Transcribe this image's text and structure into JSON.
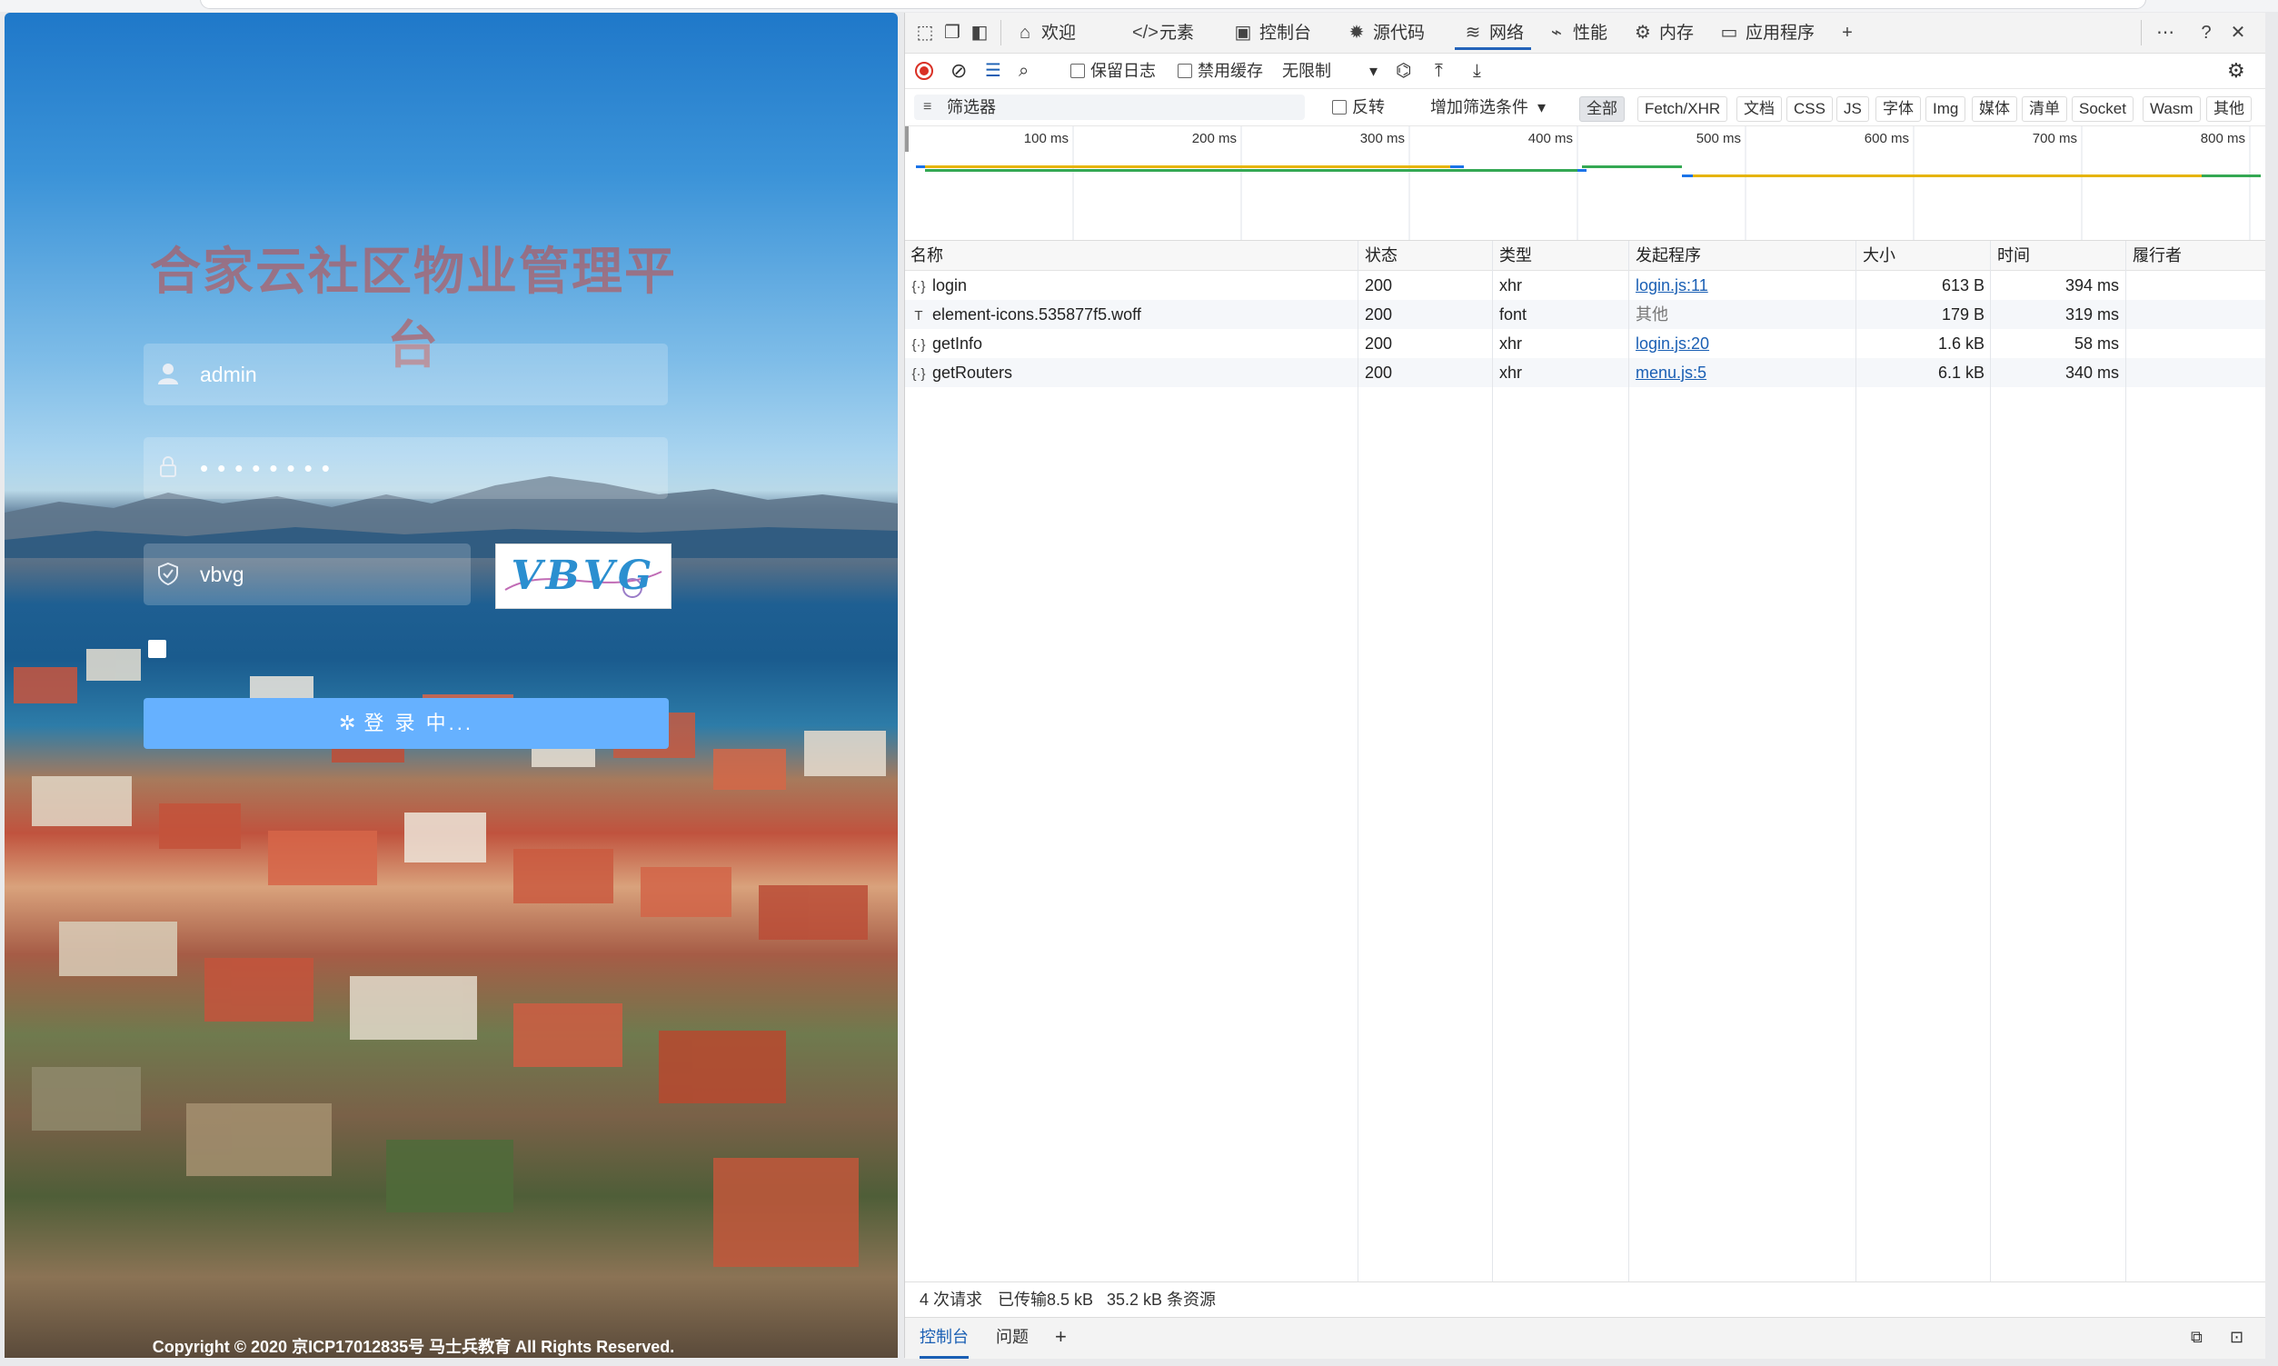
{
  "page": {
    "title": "合家云社区物业管理平台",
    "username": "admin",
    "password_mask": "••••••••",
    "captcha_input": "vbvg",
    "captcha_text": "VBVG",
    "login_button": "登 录 中...",
    "copyright": "Copyright © 2020 京ICP17012835号 马士兵教育 All Rights Reserved."
  },
  "devtools": {
    "tabs": [
      {
        "label": "欢迎",
        "icon": "home-icon"
      },
      {
        "label": "元素",
        "icon": "code-icon"
      },
      {
        "label": "控制台",
        "icon": "console-icon"
      },
      {
        "label": "源代码",
        "icon": "bug-icon"
      },
      {
        "label": "网络",
        "icon": "wifi-icon",
        "active": true
      },
      {
        "label": "性能",
        "icon": "performance-icon"
      },
      {
        "label": "内存",
        "icon": "memory-icon"
      },
      {
        "label": "应用程序",
        "icon": "application-icon"
      }
    ],
    "toolbar": {
      "preserve_log": "保留日志",
      "disable_cache": "禁用缓存",
      "throttle": "无限制"
    },
    "filter": {
      "placeholder": "筛选器",
      "invert": "反转",
      "more_filters": "增加筛选条件",
      "types": [
        "全部",
        "Fetch/XHR",
        "文档",
        "CSS",
        "JS",
        "字体",
        "Img",
        "媒体",
        "清单",
        "Socket",
        "Wasm",
        "其他"
      ]
    },
    "timeline": {
      "ticks": [
        "100 ms",
        "200 ms",
        "300 ms",
        "400 ms",
        "500 ms",
        "600 ms",
        "700 ms",
        "800 ms"
      ]
    },
    "table": {
      "columns": [
        "名称",
        "状态",
        "类型",
        "发起程序",
        "大小",
        "时间",
        "履行者"
      ],
      "rows": [
        {
          "name": "login",
          "icon": "xhr-icon",
          "status": "200",
          "type": "xhr",
          "initiator": "login.js:11",
          "initiator_link": true,
          "size": "613 B",
          "time": "394 ms"
        },
        {
          "name": "element-icons.535877f5.woff",
          "icon": "font-icon",
          "status": "200",
          "type": "font",
          "initiator": "其他",
          "initiator_link": false,
          "size": "179 B",
          "time": "319 ms"
        },
        {
          "name": "getInfo",
          "icon": "xhr-icon",
          "status": "200",
          "type": "xhr",
          "initiator": "login.js:20",
          "initiator_link": true,
          "size": "1.6 kB",
          "time": "58 ms"
        },
        {
          "name": "getRouters",
          "icon": "xhr-icon",
          "status": "200",
          "type": "xhr",
          "initiator": "menu.js:5",
          "initiator_link": true,
          "size": "6.1 kB",
          "time": "340 ms"
        }
      ]
    },
    "status": {
      "requests": "4 次请求",
      "transferred": "已传输8.5 kB",
      "resources": "35.2 kB 条资源"
    },
    "drawer": {
      "console": "控制台",
      "issues": "问题"
    },
    "colors": {
      "accent": "#1a5fb4",
      "link": "#1a5fb4",
      "record": "#d93025"
    }
  }
}
